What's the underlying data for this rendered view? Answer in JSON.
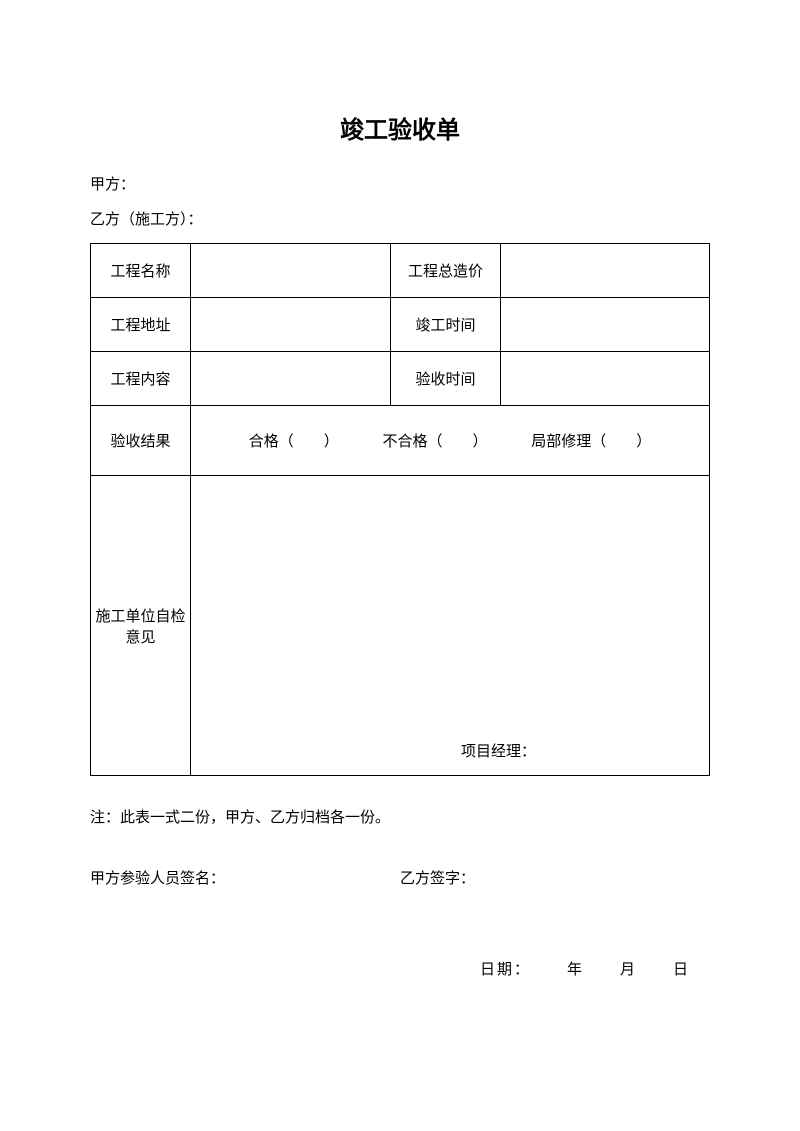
{
  "title": "竣工验收单",
  "party_a_label": "甲方：",
  "party_b_label": "乙方（施工方）：",
  "table": {
    "project_name_label": "工程名称",
    "project_name_value": "",
    "total_cost_label": "工程总造价",
    "total_cost_value": "",
    "project_address_label": "工程地址",
    "project_address_value": "",
    "completion_date_label": "竣工时间",
    "completion_date_value": "",
    "project_content_label": "工程内容",
    "project_content_value": "",
    "acceptance_date_label": "验收时间",
    "acceptance_date_value": "",
    "result_label": "验收结果",
    "result_pass": "合格（　　）",
    "result_fail": "不合格（　　）",
    "result_partial": "局部修理（　　）",
    "opinion_label": "施工单位自检意见",
    "pm_label": "项目经理："
  },
  "note": "注：此表一式二份，甲方、乙方归档各一份。",
  "sign_a": "甲方参验人员签名：",
  "sign_b": "乙方签字：",
  "date": {
    "prefix": "日期：",
    "year": "年",
    "month": "月",
    "day": "日"
  }
}
